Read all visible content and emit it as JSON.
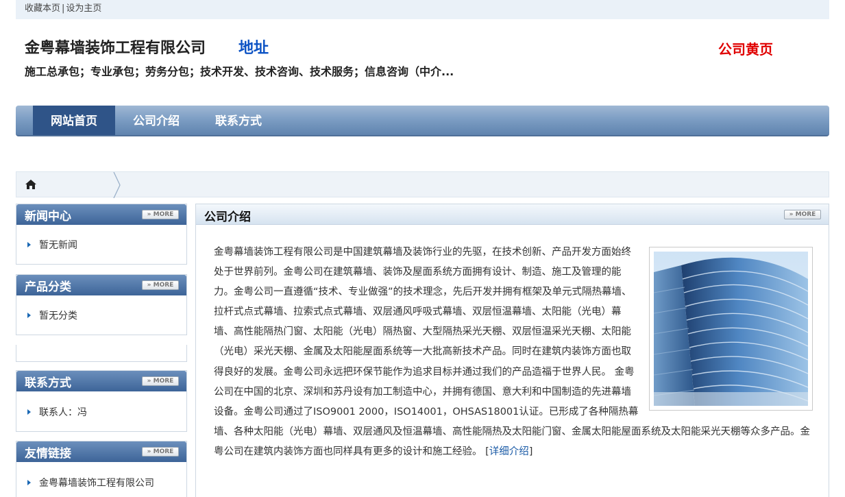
{
  "topbar": {
    "bookmark": "收藏本页",
    "separator": "|",
    "homepage": "设为主页"
  },
  "header": {
    "company_name": "金粤幕墙装饰工程有限公司",
    "address_link": "地址",
    "yellow_pages": "公司黄页",
    "slogan": "施工总承包；专业承包；劳务分包；技术开发、技术咨询、技术服务；信息咨询（中介..."
  },
  "nav": {
    "items": [
      "网站首页",
      "公司介绍",
      "联系方式"
    ],
    "active": "网站首页"
  },
  "sidebar": {
    "more_label": "» MORE",
    "news": {
      "title": "新闻中心",
      "item": "暂无新闻"
    },
    "products": {
      "title": "产品分类",
      "item": "暂无分类"
    },
    "contact": {
      "title": "联系方式",
      "item": "联系人：冯"
    },
    "links": {
      "title": "友情链接",
      "item": "金粤幕墙装饰工程有限公司"
    }
  },
  "main": {
    "title": "公司介绍",
    "more_label": "» MORE",
    "intro_text": "金粤幕墙装饰工程有限公司是中国建筑幕墙及装饰行业的先驱，在技术创新、产品开发方面始终处于世界前列。金粤公司在建筑幕墙、装饰及屋面系统方面拥有设计、制造、施工及管理的能力。金粤公司一直遵循“技术、专业做强”的技术理念，先后开发并拥有框架及单元式隔热幕墙、拉杆式点式幕墙、拉索式点式幕墙、双层通风呼吸式幕墙、双层恒温幕墙、太阳能（光电）幕墙、高性能隔热门窗、太阳能（光电）隔热窗、大型隔热采光天棚、双层恒温采光天棚、太阳能（光电）采光天棚、金属及太阳能屋面系统等一大批高新技术产品。同时在建筑内装饰方面也取得良好的发展。金粤公司永远把环保节能作为追求目标并通过我们的产品造福于世界人民。 金粤公司在中国的北京、深圳和苏丹设有加工制造中心，并拥有德国、意大利和中国制造的先进幕墙设备。金粤公司通过了ISO9001 2000，ISO14001，OHSAS18001认证。已形成了各种隔热幕墙、各种太阳能（光电）幕墙、双层通风及恒温幕墙、高性能隔热及太阳能门窗、金属太阳能屋面系统及太阳能采光天棚等众多产品。金粤公司在建筑内装饰方面也同样具有更多的设计和施工经验。",
    "detail_link": "详细介绍",
    "detail_open": " [",
    "detail_close": "]"
  },
  "colors": {
    "nav_active": "#2f5488",
    "address_link": "#0b52c4",
    "yellow_pages": "#e00000"
  },
  "icons": {
    "home": "home-icon",
    "bullet": "triangle-bullet-icon",
    "crumb": "chevron-right-icon"
  }
}
